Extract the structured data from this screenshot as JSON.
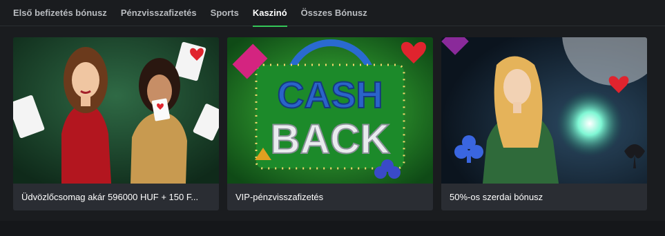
{
  "tabs": [
    {
      "label": "Első befizetés bónusz",
      "active": false
    },
    {
      "label": "Pénzvisszafizetés",
      "active": false
    },
    {
      "label": "Sports",
      "active": false
    },
    {
      "label": "Kaszinó",
      "active": true
    },
    {
      "label": "Összes Bónusz",
      "active": false
    }
  ],
  "cards": [
    {
      "title": "Üdvözlőcsomag akár 596000 HUF + 150 F..."
    },
    {
      "title": "VIP-pénzvisszafizetés",
      "art_text": [
        "CASH",
        "BACK"
      ]
    },
    {
      "title": "50%-os szerdai bónusz"
    }
  ],
  "colors": {
    "background": "#1a1c1f",
    "card": "#2a2d33",
    "accent": "#34c759"
  }
}
